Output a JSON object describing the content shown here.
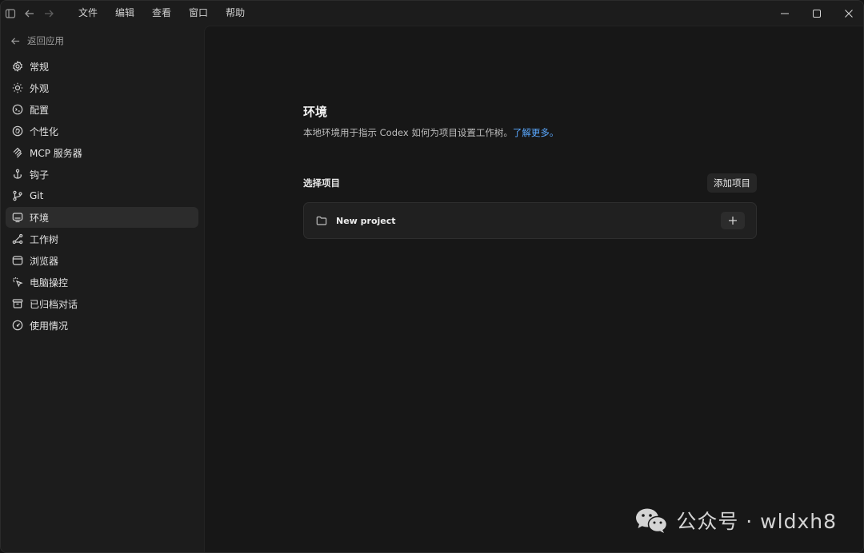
{
  "titlebar": {
    "menu": [
      {
        "label": "文件"
      },
      {
        "label": "编辑"
      },
      {
        "label": "查看"
      },
      {
        "label": "窗口"
      },
      {
        "label": "帮助"
      }
    ]
  },
  "sidebar": {
    "back_label": "返回应用",
    "items": [
      {
        "label": "常规",
        "icon": "gear-icon"
      },
      {
        "label": "外观",
        "icon": "sun-icon"
      },
      {
        "label": "配置",
        "icon": "config-icon"
      },
      {
        "label": "个性化",
        "icon": "personalize-icon"
      },
      {
        "label": "MCP 服务器",
        "icon": "mcp-icon"
      },
      {
        "label": "钩子",
        "icon": "hook-icon"
      },
      {
        "label": "Git",
        "icon": "git-branch-icon"
      },
      {
        "label": "环境",
        "icon": "monitor-icon",
        "active": true
      },
      {
        "label": "工作树",
        "icon": "worktree-icon"
      },
      {
        "label": "浏览器",
        "icon": "browser-icon"
      },
      {
        "label": "电脑操控",
        "icon": "cursor-icon"
      },
      {
        "label": "已归档对话",
        "icon": "archive-icon"
      },
      {
        "label": "使用情况",
        "icon": "gauge-icon"
      }
    ]
  },
  "main": {
    "title": "环境",
    "description": "本地环境用于指示 Codex 如何为项目设置工作树。",
    "learn_more": "了解更多。",
    "section_title": "选择项目",
    "add_project_label": "添加项目",
    "projects": [
      {
        "name": "New project"
      }
    ]
  },
  "watermark": {
    "text": "公众号 · wldxh8"
  },
  "colors": {
    "accent_link": "#5aa8ff",
    "background": "#171717",
    "sidebar": "#1c1c1c"
  }
}
